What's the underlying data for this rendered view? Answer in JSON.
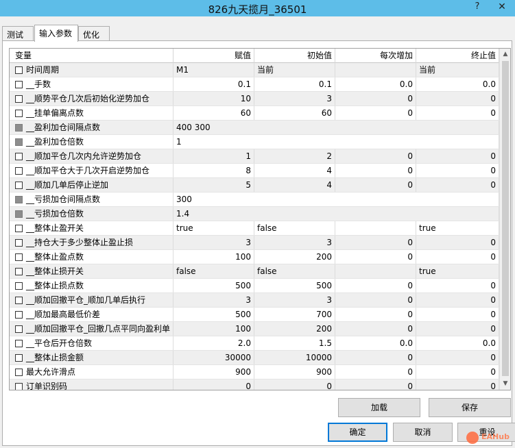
{
  "window": {
    "title": "826九天揽月_36501",
    "help": "?",
    "close": "✕"
  },
  "tabs": [
    {
      "label": "测试",
      "active": false
    },
    {
      "label": "输入参数",
      "active": true
    },
    {
      "label": "优化",
      "active": false
    }
  ],
  "table": {
    "headers": [
      "变量",
      "赋值",
      "初始值",
      "每次增加",
      "终止值"
    ],
    "rows": [
      {
        "name": "时间周期",
        "value": "M1",
        "initial": "当前",
        "step": "",
        "stop": "当前",
        "align": "left",
        "checkbox": "normal"
      },
      {
        "name": "__手数",
        "value": "0.1",
        "initial": "0.1",
        "step": "0.0",
        "stop": "0.0",
        "align": "right",
        "checkbox": "normal"
      },
      {
        "name": "__顺势平仓几次后初始化逆势加仓",
        "value": "10",
        "initial": "3",
        "step": "0",
        "stop": "0",
        "align": "right",
        "checkbox": "normal"
      },
      {
        "name": "__挂单偏离点数",
        "value": "60",
        "initial": "60",
        "step": "0",
        "stop": "0",
        "align": "right",
        "checkbox": "normal"
      },
      {
        "name": "__盈利加仓间隔点数",
        "value": "400 300",
        "align": "left",
        "checkbox": "disabled",
        "wide": true
      },
      {
        "name": "__盈利加仓倍数",
        "value": "1",
        "align": "left",
        "checkbox": "disabled",
        "wide": true
      },
      {
        "name": "__顺加平仓几次内允许逆势加仓",
        "value": "1",
        "initial": "2",
        "step": "0",
        "stop": "0",
        "align": "right",
        "checkbox": "normal"
      },
      {
        "name": "__顺加平仓大于几次开启逆势加仓",
        "value": "8",
        "initial": "4",
        "step": "0",
        "stop": "0",
        "align": "right",
        "checkbox": "normal"
      },
      {
        "name": "__顺加几单后停止逆加",
        "value": "5",
        "initial": "4",
        "step": "0",
        "stop": "0",
        "align": "right",
        "checkbox": "normal"
      },
      {
        "name": "__亏损加仓间隔点数",
        "value": "300",
        "align": "left",
        "checkbox": "disabled",
        "wide": true
      },
      {
        "name": "__亏损加仓倍数",
        "value": "1.4",
        "align": "left",
        "checkbox": "disabled",
        "wide": true
      },
      {
        "name": "__整体止盈开关",
        "value": "true",
        "initial": "false",
        "step": "",
        "stop": "true",
        "align": "left",
        "checkbox": "normal"
      },
      {
        "name": "__持仓大于多少整体止盈止损",
        "value": "3",
        "initial": "3",
        "step": "0",
        "stop": "0",
        "align": "right",
        "checkbox": "normal"
      },
      {
        "name": "__整体止盈点数",
        "value": "100",
        "initial": "200",
        "step": "0",
        "stop": "0",
        "align": "right",
        "checkbox": "normal"
      },
      {
        "name": "__整体止损开关",
        "value": "false",
        "initial": "false",
        "step": "",
        "stop": "true",
        "align": "left",
        "checkbox": "normal"
      },
      {
        "name": "__整体止损点数",
        "value": "500",
        "initial": "500",
        "step": "0",
        "stop": "0",
        "align": "right",
        "checkbox": "normal"
      },
      {
        "name": "__顺加回撤平仓_顺加几单后执行",
        "value": "3",
        "initial": "3",
        "step": "0",
        "stop": "0",
        "align": "right",
        "checkbox": "normal"
      },
      {
        "name": "__顺加最高最低价差",
        "value": "500",
        "initial": "700",
        "step": "0",
        "stop": "0",
        "align": "right",
        "checkbox": "normal"
      },
      {
        "name": "__顺加回撤平仓_回撤几点平同向盈利单",
        "value": "100",
        "initial": "200",
        "step": "0",
        "stop": "0",
        "align": "right",
        "checkbox": "normal"
      },
      {
        "name": "__平仓后开仓倍数",
        "value": "2.0",
        "initial": "1.5",
        "step": "0.0",
        "stop": "0.0",
        "align": "right",
        "checkbox": "normal"
      },
      {
        "name": "__整体止损金额",
        "value": "30000",
        "initial": "10000",
        "step": "0",
        "stop": "0",
        "align": "right",
        "checkbox": "normal"
      },
      {
        "name": "最大允许滑点",
        "value": "900",
        "initial": "900",
        "step": "0",
        "stop": "0",
        "align": "right",
        "checkbox": "normal"
      },
      {
        "name": "订单识别码",
        "value": "0",
        "initial": "0",
        "step": "0",
        "stop": "0",
        "align": "right",
        "checkbox": "normal"
      }
    ]
  },
  "scrollbar": {
    "up": "▲",
    "down": "▼"
  },
  "buttons": {
    "load": "加载",
    "save": "保存",
    "ok": "确定",
    "cancel": "取消",
    "reset": "重设"
  },
  "watermark": "EAHub"
}
